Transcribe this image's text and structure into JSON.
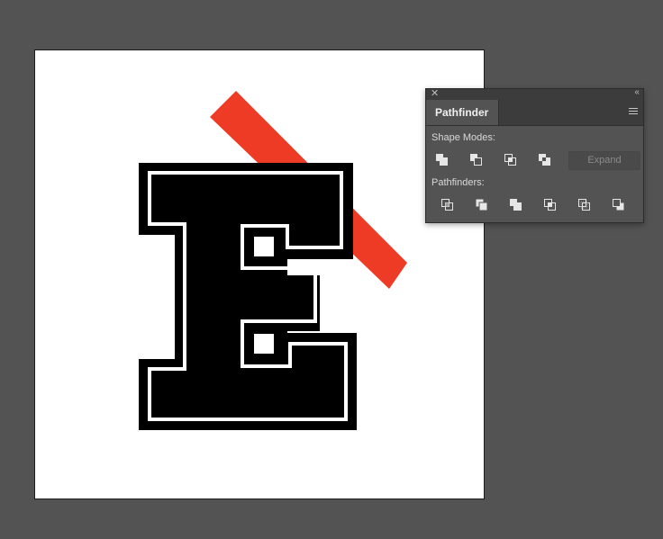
{
  "panel": {
    "close_glyph": "✕",
    "collapse_glyph": "‹‹",
    "tab_title": "Pathfinder",
    "shape_modes_label": "Shape Modes:",
    "expand_label": "Expand",
    "pathfinders_label": "Pathfinders:",
    "shape_mode_icons": [
      "unite-icon",
      "minus-front-icon",
      "intersect-icon",
      "exclude-icon"
    ],
    "pathfinder_icons": [
      "divide-icon",
      "trim-icon",
      "merge-icon",
      "crop-icon",
      "outline-icon",
      "minus-back-icon"
    ]
  },
  "artwork": {
    "letter": "E",
    "letter_color": "#000000",
    "stripe_color": "#ee3b26",
    "canvas_color": "#535353",
    "artboard_color": "#ffffff"
  }
}
